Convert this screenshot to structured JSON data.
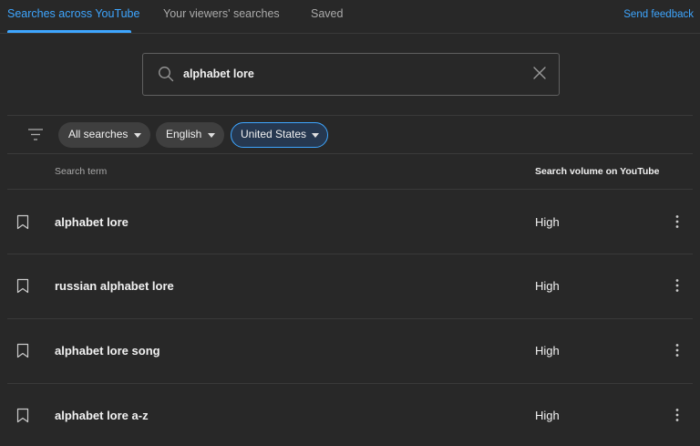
{
  "tabs": [
    {
      "label": "Searches across YouTube",
      "active": true
    },
    {
      "label": "Your viewers' searches",
      "active": false
    },
    {
      "label": "Saved",
      "active": false
    }
  ],
  "feedback_label": "Send feedback",
  "search": {
    "value": "alphabet lore",
    "icon": "search-icon",
    "clear_icon": "close-icon"
  },
  "filters": {
    "icon": "filter-icon",
    "chips": [
      {
        "label": "All searches",
        "selected": false
      },
      {
        "label": "English",
        "selected": false
      },
      {
        "label": "United States",
        "selected": true
      }
    ]
  },
  "table": {
    "headers": {
      "term": "Search term",
      "volume": "Search volume on YouTube"
    },
    "rows": [
      {
        "term": "alphabet lore",
        "volume": "High"
      },
      {
        "term": "russian alphabet lore",
        "volume": "High"
      },
      {
        "term": "alphabet lore song",
        "volume": "High"
      },
      {
        "term": "alphabet lore a-z",
        "volume": "High"
      }
    ]
  },
  "colors": {
    "accent": "#3ea6ff",
    "background": "#282828",
    "chip": "#3f3f3f"
  }
}
